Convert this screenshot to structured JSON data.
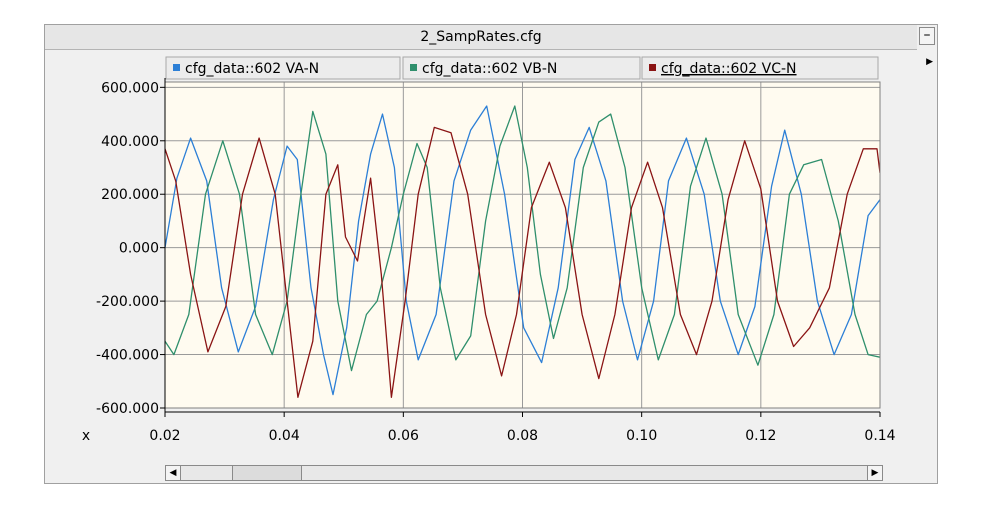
{
  "window": {
    "title": "2_SampRates.cfg",
    "minimize_label": "–"
  },
  "colors": {
    "plot_bg": "#fffbf0",
    "grid": "#9a9a9a",
    "va": "#2c7fd6",
    "vb": "#2f8f6c",
    "vc": "#8a1414"
  },
  "chart_data": {
    "type": "line",
    "title": "",
    "xlabel": "x",
    "ylabel": "",
    "xlim": [
      0.02,
      0.14
    ],
    "ylim": [
      -600,
      620
    ],
    "x_ticks": [
      0.02,
      0.04,
      0.06,
      0.08,
      0.1,
      0.12,
      0.14
    ],
    "x_tick_labels": [
      "0.02",
      "0.04",
      "0.06",
      "0.08",
      "0.10",
      "0.12",
      "0.14"
    ],
    "y_ticks": [
      600,
      400,
      200,
      0,
      -200,
      -400,
      -600
    ],
    "y_tick_labels": [
      "600.000",
      "400.000",
      "200.000",
      "0.000",
      "-200.000",
      "-400.000",
      "-600.000"
    ],
    "grid": true,
    "legend_position": "top",
    "series": [
      {
        "name": "cfg_data::602 VA-N",
        "color": "#2c7fd6",
        "points": [
          [
            0.02,
            0
          ],
          [
            0.022,
            260
          ],
          [
            0.0243,
            410
          ],
          [
            0.027,
            250
          ],
          [
            0.0295,
            -150
          ],
          [
            0.0323,
            -390
          ],
          [
            0.0352,
            -220
          ],
          [
            0.0382,
            180
          ],
          [
            0.0405,
            380
          ],
          [
            0.0422,
            330
          ],
          [
            0.0445,
            -150
          ],
          [
            0.0466,
            -400
          ],
          [
            0.0482,
            -550
          ],
          [
            0.0505,
            -300
          ],
          [
            0.0525,
            100
          ],
          [
            0.0545,
            350
          ],
          [
            0.0565,
            500
          ],
          [
            0.0585,
            300
          ],
          [
            0.0605,
            -200
          ],
          [
            0.0625,
            -420
          ],
          [
            0.0655,
            -250
          ],
          [
            0.0685,
            250
          ],
          [
            0.0713,
            440
          ],
          [
            0.074,
            530
          ],
          [
            0.077,
            200
          ],
          [
            0.0802,
            -300
          ],
          [
            0.0832,
            -430
          ],
          [
            0.086,
            -150
          ],
          [
            0.0888,
            330
          ],
          [
            0.0912,
            450
          ],
          [
            0.094,
            250
          ],
          [
            0.0968,
            -200
          ],
          [
            0.0993,
            -420
          ],
          [
            0.102,
            -200
          ],
          [
            0.1045,
            250
          ],
          [
            0.1075,
            410
          ],
          [
            0.1105,
            200
          ],
          [
            0.1132,
            -200
          ],
          [
            0.1162,
            -400
          ],
          [
            0.119,
            -220
          ],
          [
            0.1218,
            230
          ],
          [
            0.124,
            440
          ],
          [
            0.1268,
            200
          ],
          [
            0.1295,
            -200
          ],
          [
            0.1323,
            -400
          ],
          [
            0.1352,
            -250
          ],
          [
            0.138,
            120
          ],
          [
            0.14,
            180
          ]
        ]
      },
      {
        "name": "cfg_data::602 VB-N",
        "color": "#2f8f6c",
        "points": [
          [
            0.02,
            -350
          ],
          [
            0.0215,
            -400
          ],
          [
            0.024,
            -250
          ],
          [
            0.0268,
            200
          ],
          [
            0.0297,
            400
          ],
          [
            0.0325,
            200
          ],
          [
            0.0352,
            -250
          ],
          [
            0.038,
            -400
          ],
          [
            0.0405,
            -200
          ],
          [
            0.0428,
            200
          ],
          [
            0.0448,
            510
          ],
          [
            0.047,
            350
          ],
          [
            0.049,
            -200
          ],
          [
            0.0513,
            -460
          ],
          [
            0.0538,
            -250
          ],
          [
            0.0556,
            -200
          ],
          [
            0.058,
            0
          ],
          [
            0.06,
            200
          ],
          [
            0.0623,
            390
          ],
          [
            0.064,
            300
          ],
          [
            0.0662,
            -150
          ],
          [
            0.0688,
            -420
          ],
          [
            0.0713,
            -330
          ],
          [
            0.0738,
            100
          ],
          [
            0.0762,
            380
          ],
          [
            0.0787,
            530
          ],
          [
            0.0808,
            300
          ],
          [
            0.083,
            -100
          ],
          [
            0.0852,
            -340
          ],
          [
            0.0875,
            -150
          ],
          [
            0.0902,
            300
          ],
          [
            0.0928,
            470
          ],
          [
            0.0948,
            500
          ],
          [
            0.0972,
            300
          ],
          [
            0.1,
            -150
          ],
          [
            0.1028,
            -420
          ],
          [
            0.1055,
            -250
          ],
          [
            0.1082,
            230
          ],
          [
            0.1108,
            410
          ],
          [
            0.1135,
            200
          ],
          [
            0.1162,
            -250
          ],
          [
            0.1195,
            -440
          ],
          [
            0.1222,
            -250
          ],
          [
            0.1248,
            200
          ],
          [
            0.1272,
            310
          ],
          [
            0.1302,
            330
          ],
          [
            0.133,
            100
          ],
          [
            0.1358,
            -250
          ],
          [
            0.138,
            -400
          ],
          [
            0.14,
            -410
          ]
        ]
      },
      {
        "name": "cfg_data::602 VC-N",
        "color": "#8a1414",
        "points": [
          [
            0.02,
            370
          ],
          [
            0.0218,
            250
          ],
          [
            0.0243,
            -100
          ],
          [
            0.0272,
            -390
          ],
          [
            0.0302,
            -220
          ],
          [
            0.033,
            200
          ],
          [
            0.0358,
            410
          ],
          [
            0.0385,
            200
          ],
          [
            0.0405,
            -200
          ],
          [
            0.0423,
            -560
          ],
          [
            0.0448,
            -350
          ],
          [
            0.047,
            200
          ],
          [
            0.049,
            310
          ],
          [
            0.0503,
            40
          ],
          [
            0.0523,
            -50
          ],
          [
            0.0545,
            260
          ],
          [
            0.0563,
            -100
          ],
          [
            0.058,
            -560
          ],
          [
            0.0603,
            -200
          ],
          [
            0.0625,
            200
          ],
          [
            0.0652,
            450
          ],
          [
            0.068,
            430
          ],
          [
            0.0708,
            200
          ],
          [
            0.0738,
            -250
          ],
          [
            0.0765,
            -480
          ],
          [
            0.079,
            -250
          ],
          [
            0.0815,
            150
          ],
          [
            0.0845,
            320
          ],
          [
            0.0872,
            150
          ],
          [
            0.09,
            -250
          ],
          [
            0.0928,
            -490
          ],
          [
            0.0955,
            -250
          ],
          [
            0.0983,
            150
          ],
          [
            0.101,
            320
          ],
          [
            0.1035,
            150
          ],
          [
            0.1065,
            -250
          ],
          [
            0.1092,
            -400
          ],
          [
            0.1118,
            -200
          ],
          [
            0.1145,
            180
          ],
          [
            0.1173,
            400
          ],
          [
            0.12,
            220
          ],
          [
            0.1228,
            -200
          ],
          [
            0.1255,
            -370
          ],
          [
            0.1282,
            -300
          ],
          [
            0.1315,
            -150
          ],
          [
            0.1345,
            200
          ],
          [
            0.1372,
            370
          ],
          [
            0.1395,
            370
          ],
          [
            0.14,
            280
          ]
        ]
      }
    ]
  }
}
